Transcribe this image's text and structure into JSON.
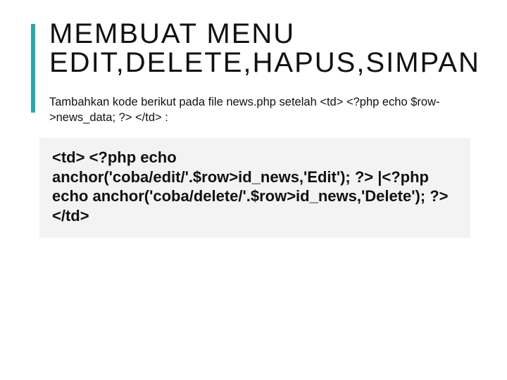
{
  "title": "MEMBUAT MENU EDIT,DELETE,HAPUS,SIMPAN",
  "intro": "Tambahkan kode berikut pada file news.php setelah <td> <?php echo $row->news_data; ?> </td> :",
  "code": "<td> <?php echo anchor('coba/edit/'.$row>id_news,'Edit'); ?> |<?php echo anchor('coba/delete/'.$row>id_news,'Delete'); ?>\n</td>"
}
